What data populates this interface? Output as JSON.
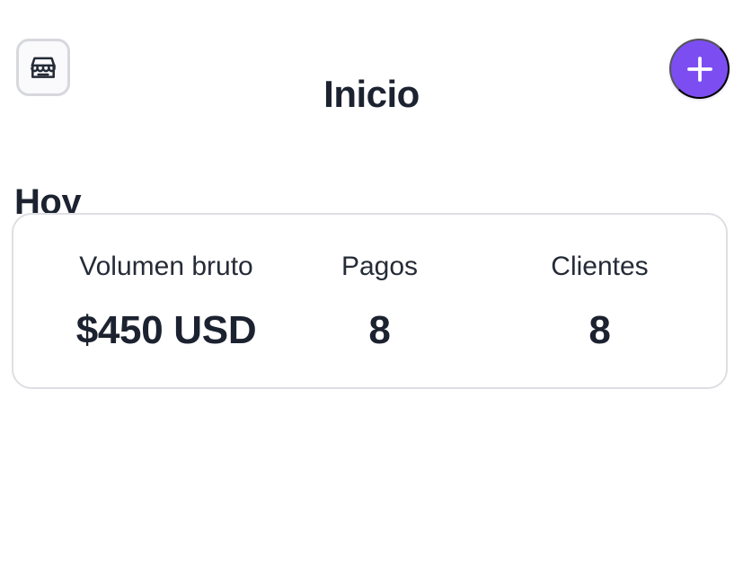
{
  "header": {
    "title": "Inicio",
    "left_button_icon": "store-icon",
    "right_button_icon": "plus-icon",
    "accent_color": "#7c4ef2"
  },
  "today": {
    "title": "Hoy",
    "metrics": [
      {
        "label": "Volumen bruto",
        "value": "$450 USD"
      },
      {
        "label": "Pagos",
        "value": "8"
      },
      {
        "label": "Clientes",
        "value": "8"
      }
    ]
  }
}
